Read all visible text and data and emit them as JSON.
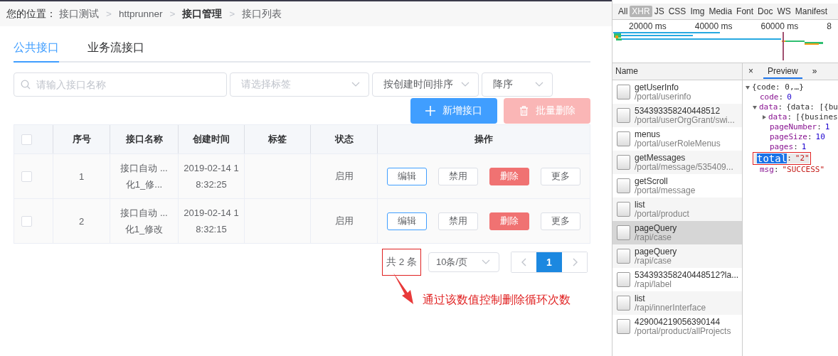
{
  "breadcrumb": {
    "label": "您的位置：",
    "items": [
      {
        "text": "接口测试",
        "current": false
      },
      {
        "text": "httprunner",
        "current": false
      },
      {
        "text": "接口管理",
        "current": true
      },
      {
        "text": "接口列表",
        "current": false
      }
    ],
    "separator": ">"
  },
  "tabs": [
    {
      "label": "公共接口",
      "selected": true
    },
    {
      "label": "业务流接口",
      "selected": false
    }
  ],
  "filters": {
    "search_placeholder": "请输入接口名称",
    "tag_placeholder": "请选择标签",
    "sort_value": "按创建时间排序",
    "order_value": "降序"
  },
  "buttons": [
    {
      "label": "新增接口",
      "kind": "primary",
      "disabled": false
    },
    {
      "label": "批量删除",
      "kind": "danger",
      "disabled": true
    }
  ],
  "table": {
    "all_checked": false,
    "columns": [
      "序号",
      "接口名称",
      "创建时间",
      "标签",
      "状态",
      "操作"
    ],
    "rows": [
      {
        "checked": false,
        "index": "1",
        "name_lines": [
          "接口自动  ...",
          "化1_修..."
        ],
        "created_lines": [
          "2019-02-14 1",
          "8:32:25"
        ],
        "status": "启用",
        "actions": [
          {
            "label": "编辑",
            "kind": "primary"
          },
          {
            "label": "禁用",
            "kind": "default"
          },
          {
            "label": "删除",
            "kind": "danger"
          },
          {
            "label": "更多",
            "kind": "default"
          }
        ]
      },
      {
        "checked": false,
        "index": "2",
        "name_lines": [
          "接口自动  ...",
          "化1_修改"
        ],
        "created_lines": [
          "2019-02-14 1",
          "8:32:15"
        ],
        "status": "启用",
        "actions": [
          {
            "label": "编辑",
            "kind": "primary"
          },
          {
            "label": "禁用",
            "kind": "default"
          },
          {
            "label": "删除",
            "kind": "danger"
          },
          {
            "label": "更多",
            "kind": "default"
          }
        ]
      }
    ]
  },
  "pagination": {
    "total": "共 2 条",
    "page_size": "10条/页",
    "pages": [
      {
        "label": "1",
        "selected": true
      }
    ]
  },
  "annotation": {
    "text": "通过该数值控制删除循环次数"
  },
  "devtools": {
    "filter_types": [
      {
        "label": "All",
        "selected": false
      },
      {
        "label": "XHR",
        "selected": true
      },
      {
        "label": "JS",
        "selected": false
      },
      {
        "label": "CSS",
        "selected": false
      },
      {
        "label": "Img",
        "selected": false
      },
      {
        "label": "Media",
        "selected": false
      },
      {
        "label": "Font",
        "selected": false
      },
      {
        "label": "Doc",
        "selected": false
      },
      {
        "label": "WS",
        "selected": false
      },
      {
        "label": "Manifest",
        "selected": false
      }
    ],
    "timeline_ticks": [
      "20000 ms",
      "40000 ms",
      "60000 ms",
      "8"
    ],
    "name_header": "Name",
    "requests": [
      {
        "name": "getUserInfo",
        "path": "/portal/userinfo",
        "selected": false
      },
      {
        "name": "534393358240448512",
        "path": "/portal/userOrgGrant/swi...",
        "selected": false
      },
      {
        "name": "menus",
        "path": "/portal/userRoleMenus",
        "selected": false
      },
      {
        "name": "getMessages",
        "path": "/portal/message/535409...",
        "selected": false
      },
      {
        "name": "getScroll",
        "path": "/portal/message",
        "selected": false
      },
      {
        "name": "list",
        "path": "/portal/product",
        "selected": false
      },
      {
        "name": "pageQuery",
        "path": "/rapi/case",
        "selected": true
      },
      {
        "name": "pageQuery",
        "path": "/rapi/case",
        "selected": false
      },
      {
        "name": "534393358240448512?la...",
        "path": "/rapi/label",
        "selected": false
      },
      {
        "name": "list",
        "path": "/rapi/innerInterface",
        "selected": false
      },
      {
        "name": "429004219056390144",
        "path": "/portal/product/allProjects",
        "selected": false
      }
    ],
    "panel_tabs": [
      {
        "label": "×",
        "kind": "close",
        "selected": false
      },
      {
        "label": "Preview",
        "kind": "tab",
        "selected": true
      },
      {
        "label": "»",
        "kind": "more",
        "selected": false
      }
    ],
    "preview": {
      "summary": "{code: 0,…}",
      "separator": ":",
      "expanded": true,
      "children": [
        {
          "key": "code",
          "value": "0",
          "kind": "number",
          "selected": false,
          "annotated": false
        },
        {
          "key": "data",
          "value": "{data: [{bu",
          "kind": "object",
          "expanded": true,
          "children": [
            {
              "key": "data",
              "value": "[{busines",
              "kind": "object",
              "expanded": false
            },
            {
              "key": "pageNumber",
              "value": "1",
              "kind": "number",
              "selected": false,
              "annotated": false
            },
            {
              "key": "pageSize",
              "value": "10",
              "kind": "number",
              "selected": false,
              "annotated": false
            },
            {
              "key": "pages",
              "value": "1",
              "kind": "number",
              "selected": false,
              "annotated": false
            },
            {
              "key": "total",
              "value": "\"2\"",
              "kind": "string",
              "selected": true,
              "annotated": true
            }
          ]
        },
        {
          "key": "msg",
          "value": "\"SUCCESS\"",
          "kind": "string",
          "selected": false,
          "annotated": false
        }
      ]
    }
  }
}
